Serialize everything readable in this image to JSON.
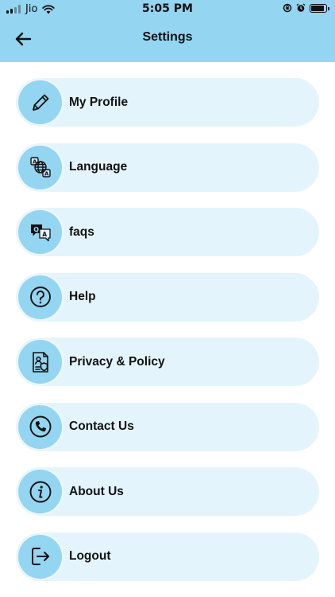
{
  "status_bar": {
    "carrier": "Jio",
    "time": "5:05 PM",
    "battery_level": 0.9
  },
  "header": {
    "title": "Settings",
    "back_icon": "arrow-left-icon"
  },
  "colors": {
    "header_bg": "#94d5f1",
    "item_bg": "#e4f4fc",
    "icon_circle": "#94d5f1",
    "text": "#111111"
  },
  "menu": {
    "items": [
      {
        "id": "my-profile",
        "label": "My Profile",
        "icon": "pencil-icon"
      },
      {
        "id": "language",
        "label": "Language",
        "icon": "translate-icon"
      },
      {
        "id": "faqs",
        "label": "faqs",
        "icon": "qa-chat-icon"
      },
      {
        "id": "help",
        "label": "Help",
        "icon": "question-circle-icon"
      },
      {
        "id": "privacy-policy",
        "label": "Privacy & Policy",
        "icon": "privacy-document-icon"
      },
      {
        "id": "contact-us",
        "label": "Contact Us",
        "icon": "phone-icon"
      },
      {
        "id": "about-us",
        "label": "About Us",
        "icon": "info-icon"
      },
      {
        "id": "logout",
        "label": "Logout",
        "icon": "logout-icon"
      }
    ]
  }
}
